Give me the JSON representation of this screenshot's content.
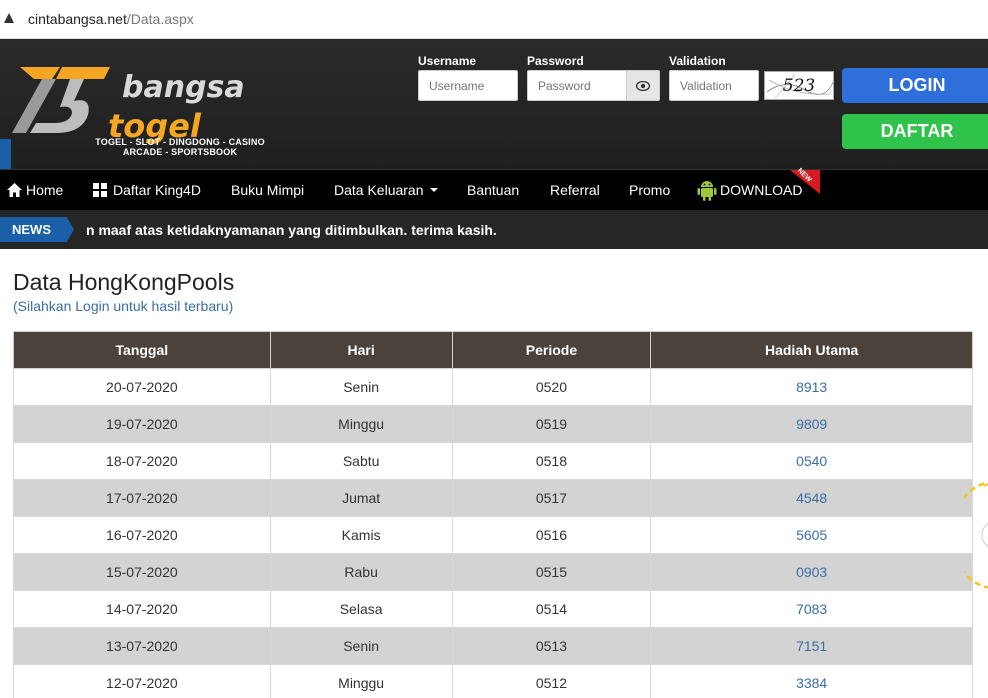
{
  "browser": {
    "url_host": "cintabangsa.net",
    "url_path": "/Data.aspx"
  },
  "brand": {
    "word1": "bangsa",
    "word2": "togel",
    "tagline1": "TOGEL - SLOT - DINGDONG - CASINO",
    "tagline2": "ARCADE - SPORTSBOOK",
    "accent": "#f5a623"
  },
  "login": {
    "username_label": "Username",
    "username_placeholder": "Username",
    "password_label": "Password",
    "password_placeholder": "Password",
    "validation_label": "Validation",
    "validation_placeholder": "Validation",
    "captcha_text": "523",
    "login_button": "LOGIN",
    "daftar_button": "DAFTAR"
  },
  "nav": {
    "home": "Home",
    "daftar_king4d": "Daftar King4D",
    "buku_mimpi": "Buku Mimpi",
    "data_keluaran": "Data Keluaran",
    "bantuan": "Bantuan",
    "referral": "Referral",
    "promo": "Promo",
    "download": "DOWNLOAD",
    "new_badge": "NEW"
  },
  "news": {
    "badge": "NEWS",
    "text": "n maaf atas ketidaknyamanan yang ditimbulkan. terima kasih."
  },
  "page": {
    "title": "Data HongKongPools",
    "subtitle": "(Silahkan Login untuk hasil terbaru)"
  },
  "table": {
    "headers": [
      "Tanggal",
      "Hari",
      "Periode",
      "Hadiah Utama"
    ],
    "rows": [
      [
        "20-07-2020",
        "Senin",
        "0520",
        "8913"
      ],
      [
        "19-07-2020",
        "Minggu",
        "0519",
        "9809"
      ],
      [
        "18-07-2020",
        "Sabtu",
        "0518",
        "0540"
      ],
      [
        "17-07-2020",
        "Jumat",
        "0517",
        "4548"
      ],
      [
        "16-07-2020",
        "Kamis",
        "0516",
        "5605"
      ],
      [
        "15-07-2020",
        "Rabu",
        "0515",
        "0903"
      ],
      [
        "14-07-2020",
        "Selasa",
        "0514",
        "7083"
      ],
      [
        "13-07-2020",
        "Senin",
        "0513",
        "7151"
      ],
      [
        "12-07-2020",
        "Minggu",
        "0512",
        "3384"
      ]
    ]
  }
}
